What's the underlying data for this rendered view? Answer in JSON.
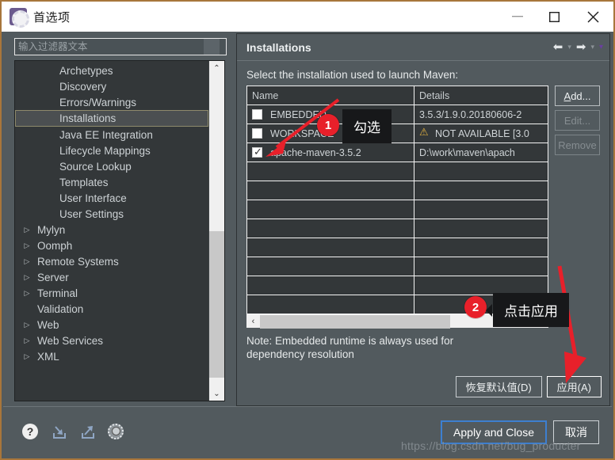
{
  "window": {
    "title": "首选项",
    "icon": "preferences-gear-icon",
    "controls": {
      "minimize": "—",
      "maximize": "□",
      "close": "✕"
    }
  },
  "sidebar": {
    "filter": {
      "placeholder": "输入过滤器文本",
      "value": ""
    },
    "items": [
      {
        "label": "Archetypes",
        "level": "child",
        "expandable": false
      },
      {
        "label": "Discovery",
        "level": "child",
        "expandable": false
      },
      {
        "label": "Errors/Warnings",
        "level": "child",
        "expandable": false
      },
      {
        "label": "Installations",
        "level": "child",
        "expandable": false,
        "selected": true
      },
      {
        "label": "Java EE Integration",
        "level": "child",
        "expandable": false
      },
      {
        "label": "Lifecycle Mappings",
        "level": "child",
        "expandable": false
      },
      {
        "label": "Source Lookup",
        "level": "child",
        "expandable": false
      },
      {
        "label": "Templates",
        "level": "child",
        "expandable": false
      },
      {
        "label": "User Interface",
        "level": "child",
        "expandable": false
      },
      {
        "label": "User Settings",
        "level": "child",
        "expandable": false
      },
      {
        "label": "Mylyn",
        "level": "top",
        "expandable": true
      },
      {
        "label": "Oomph",
        "level": "top",
        "expandable": true
      },
      {
        "label": "Remote Systems",
        "level": "top",
        "expandable": true
      },
      {
        "label": "Server",
        "level": "top",
        "expandable": true
      },
      {
        "label": "Terminal",
        "level": "top",
        "expandable": true
      },
      {
        "label": "Validation",
        "level": "top",
        "expandable": false
      },
      {
        "label": "Web",
        "level": "top",
        "expandable": true
      },
      {
        "label": "Web Services",
        "level": "top",
        "expandable": true
      },
      {
        "label": "XML",
        "level": "top",
        "expandable": true
      }
    ],
    "scroll": {
      "up": "⌃",
      "down": "⌄"
    }
  },
  "main": {
    "title": "Installations",
    "nav": {
      "back": "⬅",
      "back_menu": "▾",
      "forward": "➡",
      "forward_menu": "▾",
      "view_menu": "▾"
    },
    "description": "Select the installation used to launch Maven:",
    "table": {
      "columns": [
        "Name",
        "Details"
      ],
      "rows": [
        {
          "checked": false,
          "name": "EMBEDDED",
          "details": "3.5.3/1.9.0.20180606-2",
          "warning": false
        },
        {
          "checked": false,
          "name": "WORKSPACE",
          "details": "NOT AVAILABLE [3.0",
          "warning": true
        },
        {
          "checked": true,
          "name": "apache-maven-3.5.2",
          "details": "D:\\work\\maven\\apach",
          "warning": false
        }
      ],
      "empty_row_count": 8
    },
    "hscroll": {
      "left": "‹",
      "right": "›"
    },
    "side_buttons": [
      {
        "label": "Add...",
        "accel": "A",
        "enabled": true
      },
      {
        "label": "Edit...",
        "accel": "",
        "enabled": false
      },
      {
        "label": "Remove",
        "accel": "",
        "enabled": false
      }
    ],
    "note": "Note: Embedded runtime is always used for dependency resolution",
    "restore_defaults_label": "恢复默认值(D)",
    "apply_label": "应用(A)"
  },
  "footer": {
    "icons": [
      "help-icon",
      "import-icon",
      "export-icon",
      "settings-icon"
    ],
    "apply_and_close_label": "Apply and Close",
    "cancel_label": "取消"
  },
  "annotations": [
    {
      "number": "1",
      "text": "勾选"
    },
    {
      "number": "2",
      "text": "点击应用"
    }
  ],
  "watermark": "https://blog.csdn.net/bug_producter",
  "colors": {
    "accent_red": "#e8202a",
    "focus_blue": "#3d7fd0",
    "window_border": "#a8763b",
    "panel_bg": "#525a5e",
    "tree_bg": "#333739"
  }
}
